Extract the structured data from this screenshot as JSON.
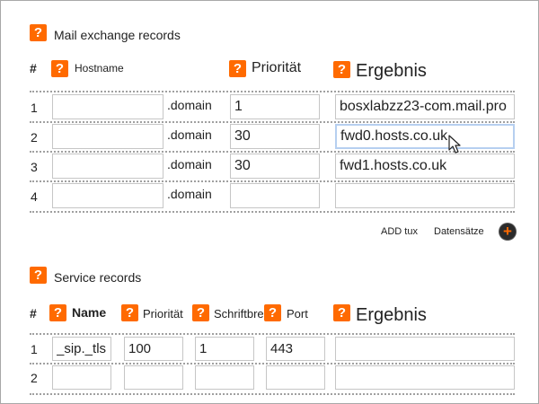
{
  "mx": {
    "title": "Mail exchange records",
    "headers": {
      "index": "#",
      "hostname": "Hostname",
      "priority": "Priorität",
      "result": "Ergebnis"
    },
    "rows": [
      {
        "index": "1",
        "hostname": "",
        "suffix": ".domain",
        "priority": "1",
        "result": "bosxlabzz23-com.mail.pro"
      },
      {
        "index": "2",
        "hostname": "",
        "suffix": ".domain",
        "priority": "30",
        "result": "fwd0.hosts.co.uk"
      },
      {
        "index": "3",
        "hostname": "",
        "suffix": ".domain",
        "priority": "30",
        "result": "fwd1.hosts.co.uk"
      },
      {
        "index": "4",
        "hostname": "",
        "suffix": ".domain",
        "priority": "",
        "result": ""
      }
    ],
    "add_label": "ADD tux",
    "records_label": "Datensätze"
  },
  "srv": {
    "title": "Service records",
    "headers": {
      "index": "#",
      "name": "Name",
      "priority": "Priorität",
      "weight": "Schriftbreite",
      "port": "Port",
      "result": "Ergebnis"
    },
    "rows": [
      {
        "index": "1",
        "name": "_sip._tls",
        "priority": "100",
        "weight": "1",
        "port": "443",
        "result": ""
      },
      {
        "index": "2",
        "name": "",
        "priority": "",
        "weight": "",
        "port": "",
        "result": ""
      }
    ]
  },
  "icons": {
    "help": "?"
  },
  "colors": {
    "accent": "#ff6a00",
    "border": "#c6c6c6",
    "focus": "#b6cff0"
  }
}
